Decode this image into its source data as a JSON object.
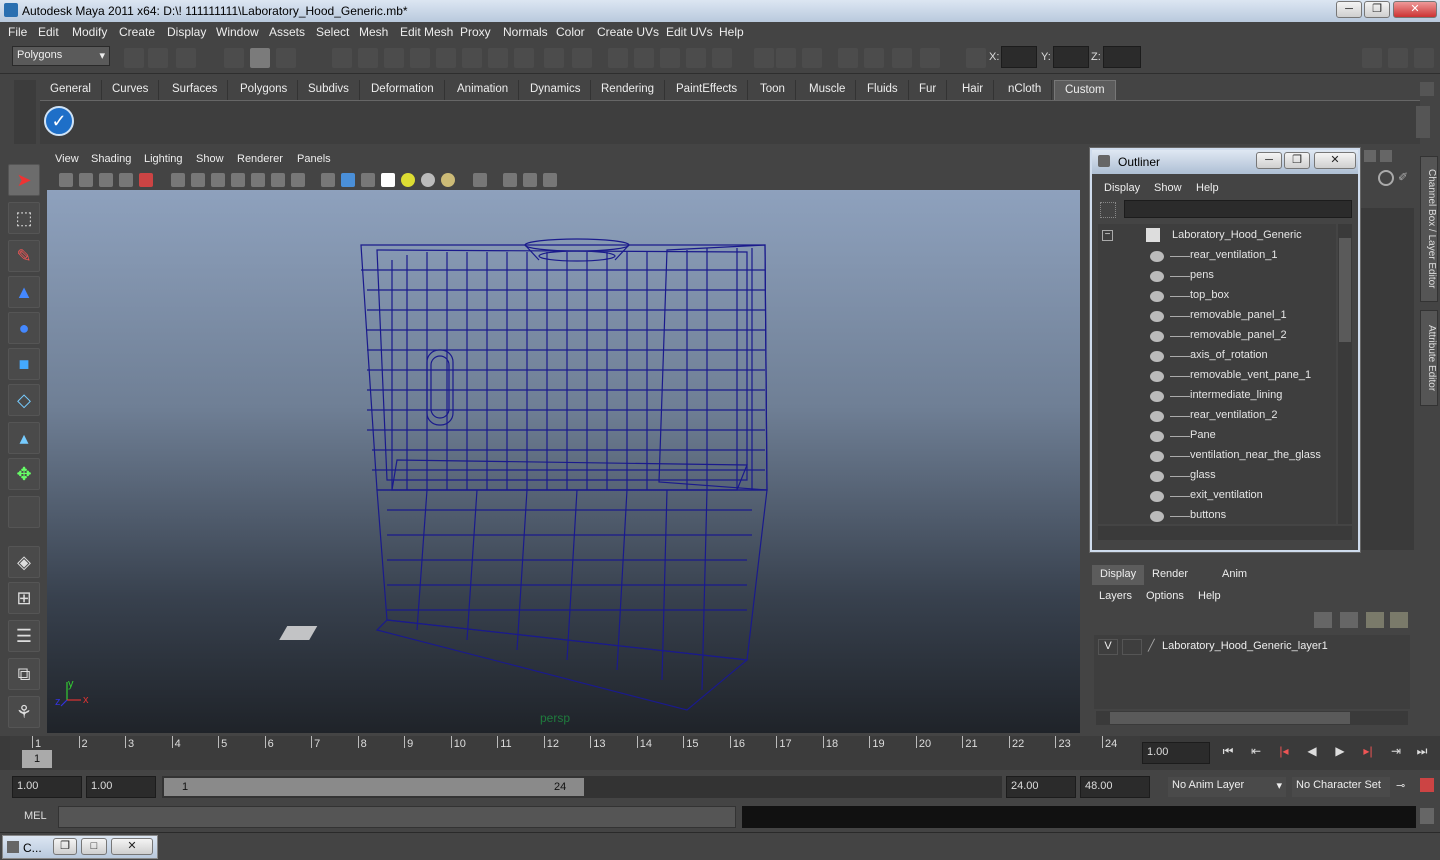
{
  "title": "Autodesk Maya 2011 x64: D:\\! 111111111\\Laboratory_Hood_Generic.mb*",
  "window_controls": [
    "─",
    "❐",
    "✕"
  ],
  "menu": [
    "File",
    "Edit",
    "Modify",
    "Create",
    "Display",
    "Window",
    "Assets",
    "Select",
    "Mesh",
    "Edit Mesh",
    "Proxy",
    "Normals",
    "Color",
    "Create UVs",
    "Edit UVs",
    "Help"
  ],
  "mode_select": "Polygons",
  "coord_labels": {
    "x": "X:",
    "y": "Y:",
    "z": "Z:"
  },
  "shelf_tabs": [
    "General",
    "Curves",
    "Surfaces",
    "Polygons",
    "Subdivs",
    "Deformation",
    "Animation",
    "Dynamics",
    "Rendering",
    "PaintEffects",
    "Toon",
    "Muscle",
    "Fluids",
    "Fur",
    "Hair",
    "nCloth",
    "Custom"
  ],
  "shelf_active": "Custom",
  "viewport_menu": [
    "View",
    "Shading",
    "Lighting",
    "Show",
    "Renderer",
    "Panels"
  ],
  "viewport_camera": "persp",
  "axis": {
    "x": "x",
    "y": "y",
    "z": "z"
  },
  "outliner": {
    "title": "Outliner",
    "menu": [
      "Display",
      "Show",
      "Help"
    ],
    "root": "Laboratory_Hood_Generic",
    "items": [
      "rear_ventilation_1",
      "pens",
      "top_box",
      "removable_panel_1",
      "removable_panel_2",
      "axis_of_rotation",
      "removable_vent_pane_1",
      "intermediate_lining",
      "rear_ventilation_2",
      "Pane",
      "ventilation_near_the_glass",
      "glass",
      "exit_ventilation",
      "buttons"
    ]
  },
  "side_tabs": [
    "Channel Box / Layer Editor",
    "Attribute Editor"
  ],
  "layer_editor": {
    "tabs": [
      "Display",
      "Render",
      "Anim"
    ],
    "menu": [
      "Layers",
      "Options",
      "Help"
    ],
    "layer_visible": "V",
    "layer_name": "Laboratory_Hood_Generic_layer1"
  },
  "timeline": {
    "ticks": [
      "1",
      "2",
      "3",
      "4",
      "5",
      "6",
      "7",
      "8",
      "9",
      "10",
      "11",
      "12",
      "13",
      "14",
      "15",
      "16",
      "17",
      "18",
      "19",
      "20",
      "21",
      "22",
      "23",
      "24"
    ],
    "current_frame_marker": "1",
    "current_time": "1.00"
  },
  "range": {
    "start": "1.00",
    "playback_start": "1.00",
    "slider_start": "1",
    "slider_end": "24",
    "playback_end": "24.00",
    "end": "48.00",
    "anim_layer": "No Anim Layer",
    "character_set": "No Character Set"
  },
  "mel_label": "MEL",
  "taskbar_item": "C...",
  "colors": {
    "wire": "#1a1a8c",
    "accent_blue": "#1e6fc8",
    "persp_label": "#1f7c3d"
  }
}
